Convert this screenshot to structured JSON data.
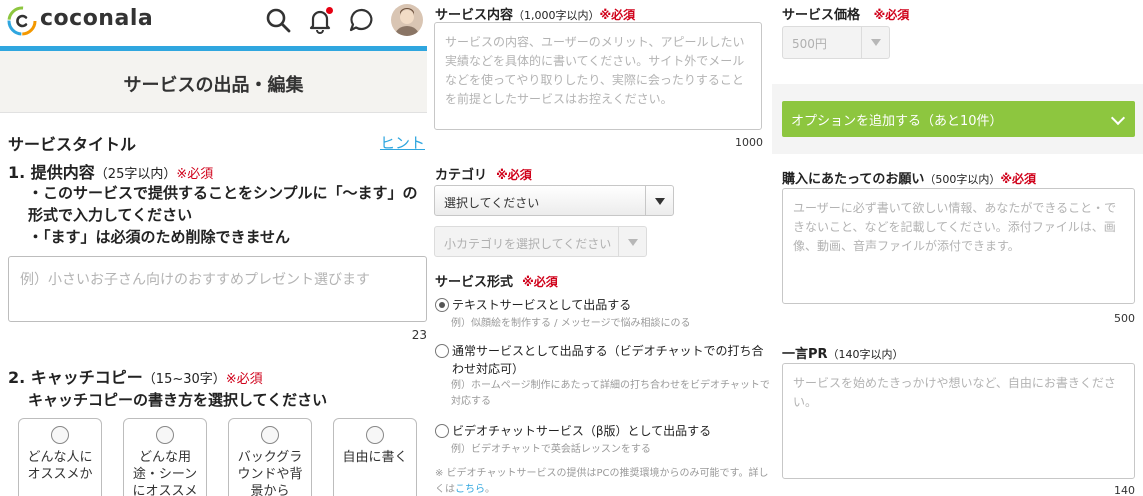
{
  "header": {
    "logo_text": "coconala",
    "icons": [
      "search-icon",
      "bell-icon",
      "chat-icon",
      "avatar"
    ]
  },
  "page_title": "サービスの出品・編集",
  "colors": {
    "accent_blue": "#2fa6df",
    "required_red": "#d0021b",
    "green_button": "#8dc63f"
  },
  "section_title": {
    "text": "サービスタイトル",
    "hint_label": "ヒント"
  },
  "q1": {
    "title": "1. 提供内容",
    "limit": "（25字以内）",
    "required": "※必須",
    "instructions": [
      "・このサービスで提供することをシンプルに「〜ます」の形式で入力してください",
      "・「ます」は必須のため削除できません"
    ],
    "placeholder": "例）小さいお子さん向けのおすすめプレゼント選びます",
    "counter": "23"
  },
  "q2": {
    "title": "2. キャッチコピー",
    "limit": "（15~30字）",
    "required": "※必須",
    "instruction": "キャッチコピーの書き方を選択してください",
    "options": [
      "どんな人にオススメか",
      "どんな用途・シーンにオススメか",
      "バックグラウンドや背景から",
      "自由に書く"
    ]
  },
  "service_content": {
    "label": "サービス内容",
    "limit": "（1,000字以内）",
    "required": "※必須",
    "placeholder": "サービスの内容、ユーザーのメリット、アピールしたい実績などを具体的に書いてください。サイト外でメールなどを使ってやり取りしたり、実際に会ったりすることを前提としたサービスはお控えください。",
    "counter": "1000"
  },
  "category": {
    "label": "カテゴリ",
    "required": "※必須",
    "select_value": "選択してください",
    "sub_select_value": "小カテゴリを選択してください"
  },
  "service_format": {
    "label": "サービス形式",
    "required": "※必須",
    "options": [
      {
        "label": "テキストサービスとして出品する",
        "note": "例）似顔絵を制作する / メッセージで悩み相談にのる",
        "selected": true
      },
      {
        "label": "通常サービスとして出品する（ビデオチャットでの打ち合わせ対応可）",
        "note": "例）ホームページ制作にあたって詳細の打ち合わせをビデオチャットで対応する",
        "selected": false
      },
      {
        "label": "ビデオチャットサービス（β版）として出品する",
        "note": "例）ビデオチャットで英会話レッスンをする",
        "selected": false
      }
    ],
    "footnote": "※ ビデオチャットサービスの提供はPCの推奨環境からのみ可能です。詳しくは",
    "footnote_link": "こちら",
    "footnote_end": "。"
  },
  "price": {
    "label": "サービス価格",
    "required": "※必須",
    "select_value": "500円"
  },
  "add_option_button": "オプションを追加する（あと10件）",
  "purchase_request": {
    "label": "購入にあたってのお願い",
    "limit": "（500字以内）",
    "required": "※必須",
    "placeholder": "ユーザーに必ず書いて欲しい情報、あなたができること・できないこと、などを記載してください。添付ファイルは、画像、動画、音声ファイルが添付できます。",
    "counter": "500"
  },
  "pr": {
    "label": "一言PR",
    "limit": "（140字以内）",
    "placeholder": "サービスを始めたきっかけや想いなど、自由にお書きください。",
    "counter": "140"
  }
}
